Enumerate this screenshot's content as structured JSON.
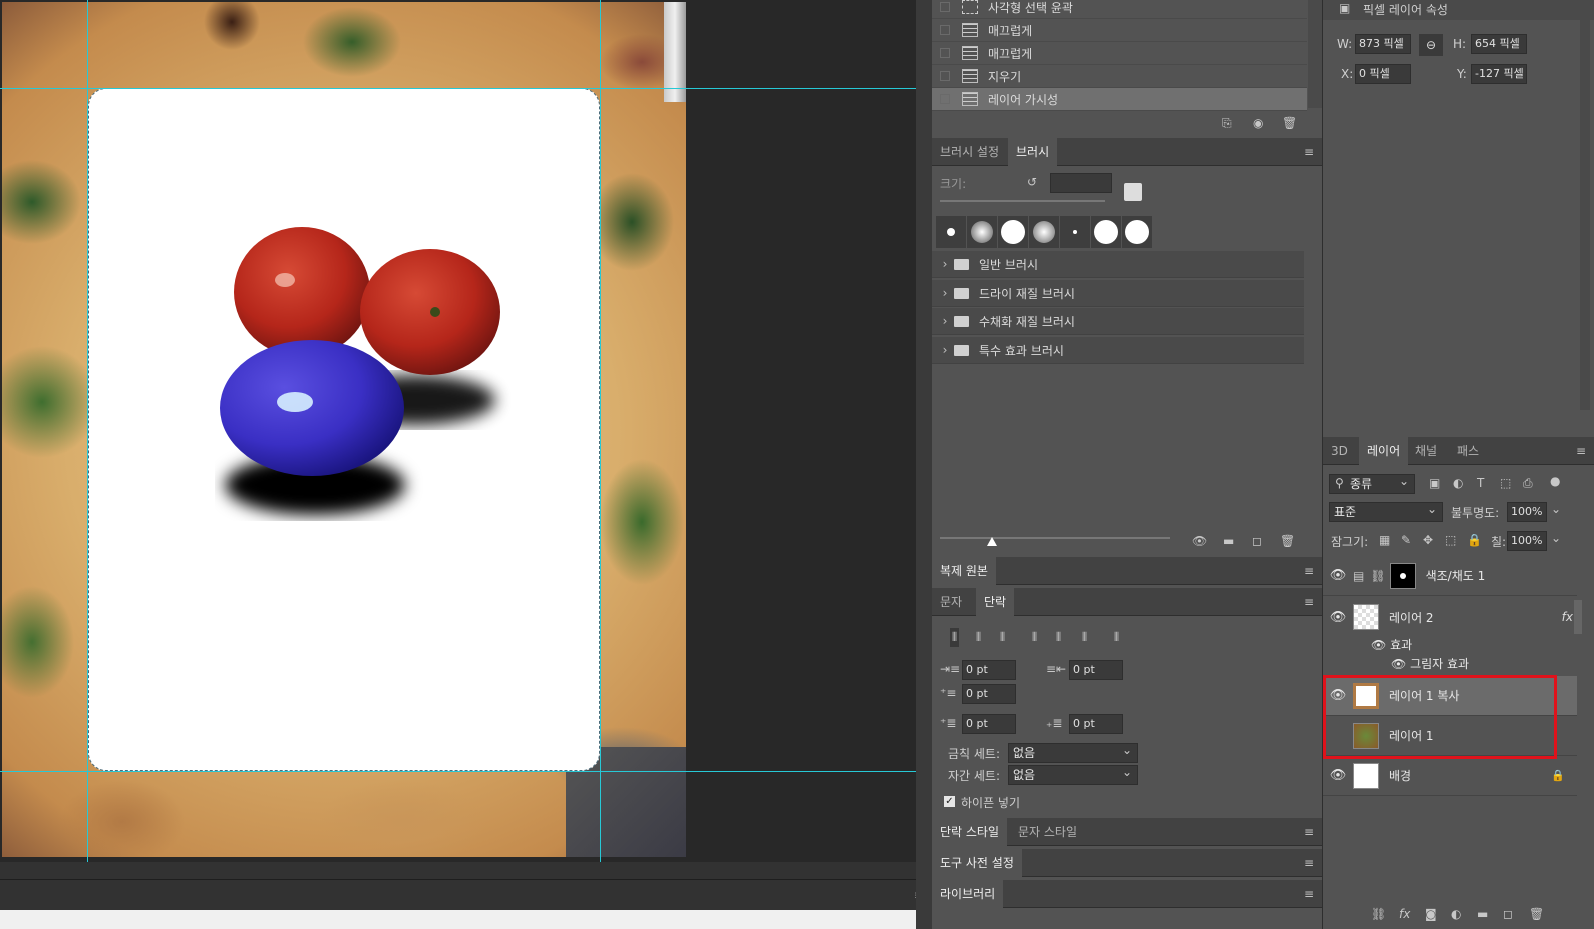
{
  "history": {
    "items": [
      {
        "label": "사각형 선택 윤곽",
        "selected": false
      },
      {
        "label": "매끄럽게",
        "selected": false
      },
      {
        "label": "매끄럽게",
        "selected": false
      },
      {
        "label": "지우기",
        "selected": false
      },
      {
        "label": "레이어 가시성",
        "selected": true
      }
    ]
  },
  "brush_panel": {
    "tabs": [
      "브러시 설정",
      "브러시"
    ],
    "active_tab": "브러시",
    "size_label": "크기:",
    "folders": [
      "일반 브러시",
      "드라이 재질 브러시",
      "수채화 재질 브러시",
      "특수 효과 브러시"
    ]
  },
  "clone_source": {
    "title": "복제 원본"
  },
  "para_panel": {
    "tabs": [
      "문자",
      "단락"
    ],
    "active_tab": "단락",
    "indent_left": "0 pt",
    "indent_right": "0 pt",
    "indent_first": "0 pt",
    "space_before": "0 pt",
    "space_after": "0 pt",
    "kinsoku_label": "금칙 세트:",
    "kinsoku_value": "없음",
    "mojikumi_label": "자간 세트:",
    "mojikumi_value": "없음",
    "hyphenate_label": "하이픈 넣기",
    "hyphenate_checked": true
  },
  "style_panel": {
    "tabs": [
      "단락 스타일",
      "문자 스타일"
    ]
  },
  "tool_presets": {
    "title": "도구 사전 설정"
  },
  "libraries": {
    "title": "라이브러리"
  },
  "properties": {
    "title": "픽셀 레이어 속성",
    "w_label": "W:",
    "w_value": "873 픽셀",
    "h_label": "H:",
    "h_value": "654 픽셀",
    "x_label": "X:",
    "x_value": "0 픽셀",
    "y_label": "Y:",
    "y_value": "-127 픽셀"
  },
  "layers_panel": {
    "tabs": [
      "3D",
      "레이어",
      "채널",
      "패스"
    ],
    "active_tab": "레이어",
    "filter_kind": "종류",
    "blend_mode": "표준",
    "opacity_label": "불투명도:",
    "opacity_value": "100%",
    "lock_label": "잠그기:",
    "fill_label": "칠:",
    "fill_value": "100%",
    "layers": [
      {
        "name": "색조/채도 1",
        "visible": true,
        "kind": "adjustment"
      },
      {
        "name": "레이어 2",
        "visible": true,
        "kind": "pixel",
        "fx": "fx"
      },
      {
        "name": "효과",
        "visible": true,
        "kind": "effect-group"
      },
      {
        "name": "그림자 효과",
        "visible": true,
        "kind": "effect"
      },
      {
        "name": "레이어 1 복사",
        "visible": true,
        "kind": "pixel",
        "selected": true
      },
      {
        "name": "레이어 1",
        "visible": false,
        "kind": "pixel"
      },
      {
        "name": "배경",
        "visible": true,
        "kind": "background",
        "locked": true
      }
    ]
  },
  "colors": {
    "highlight": "#e0121b",
    "guide": "#27c9d6"
  }
}
